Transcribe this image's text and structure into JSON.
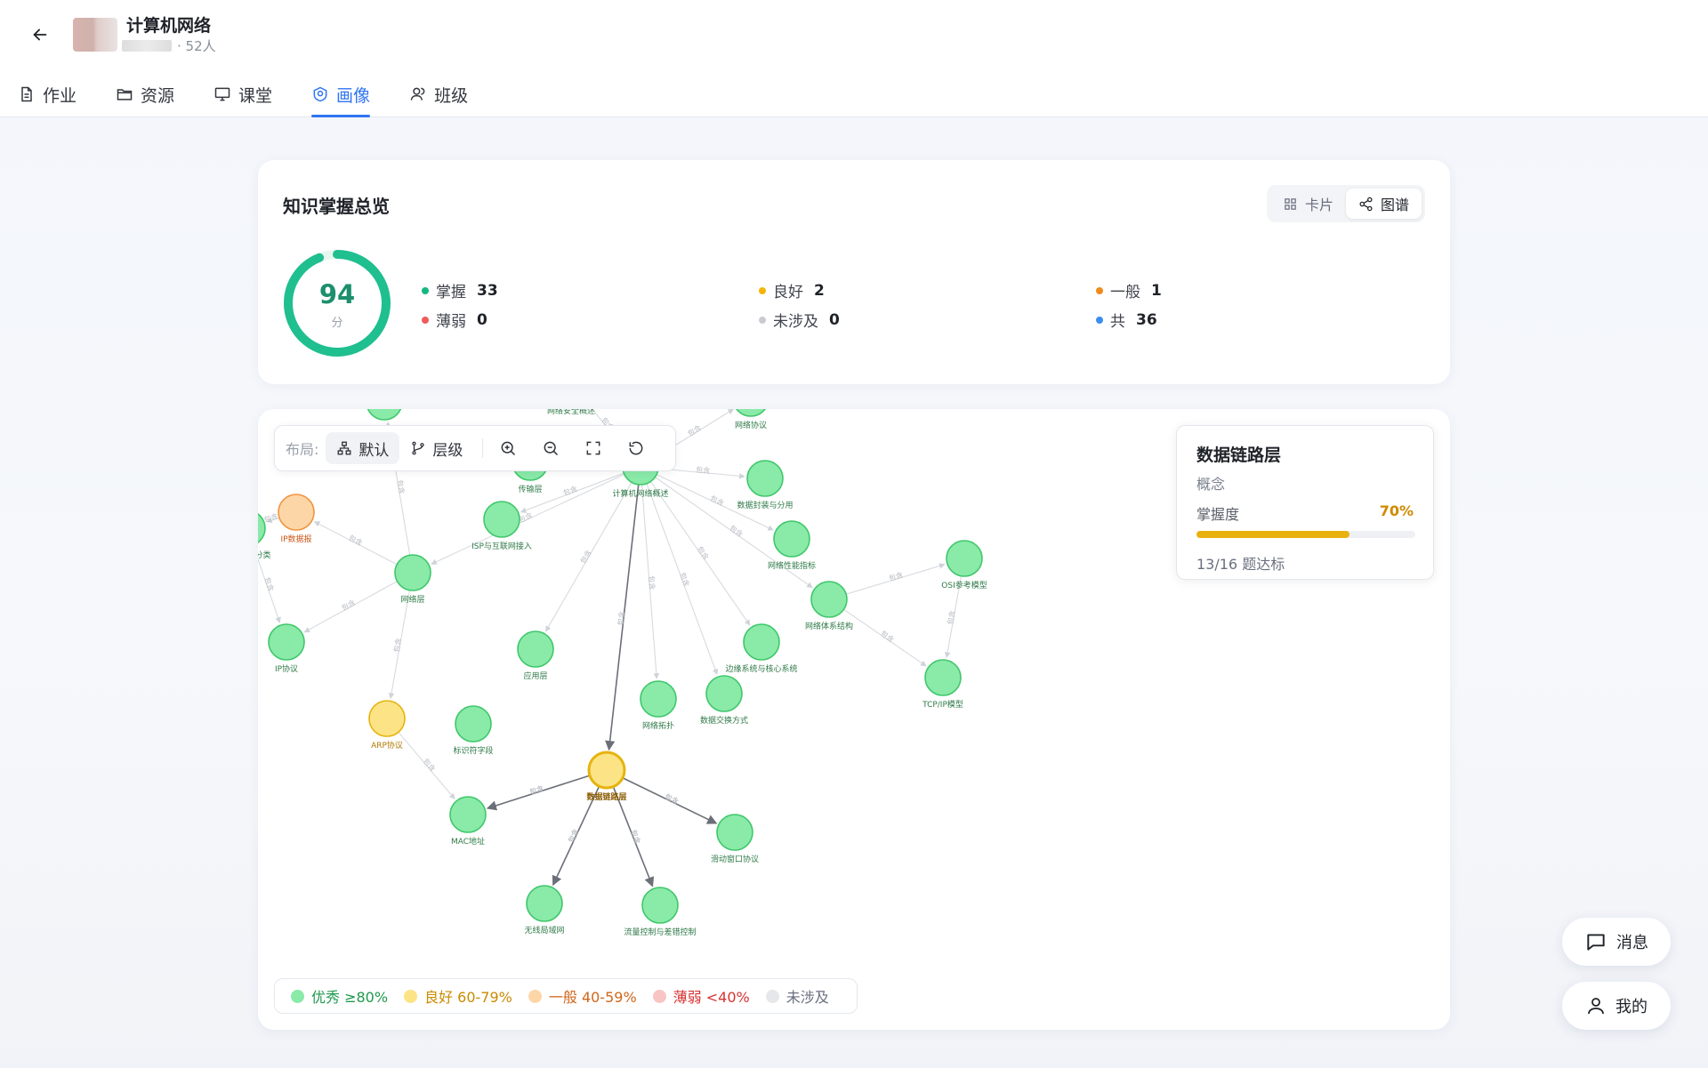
{
  "header": {
    "course_title": "计算机网络",
    "member_count": "· 52人"
  },
  "tabs": [
    {
      "label": "作业",
      "icon": "file-icon"
    },
    {
      "label": "资源",
      "icon": "folder-icon"
    },
    {
      "label": "课堂",
      "icon": "monitor-icon"
    },
    {
      "label": "画像",
      "icon": "portrait-icon",
      "active": true
    },
    {
      "label": "班级",
      "icon": "users-icon"
    }
  ],
  "overview": {
    "title": "知识掌握总览",
    "view_card": "卡片",
    "view_graph": "图谱",
    "score": "94",
    "score_unit": "分",
    "score_fraction": 0.94,
    "stats": [
      {
        "label": "掌握",
        "value": "33",
        "color": "#14b87e"
      },
      {
        "label": "薄弱",
        "value": "0",
        "color": "#ef5b5b"
      },
      {
        "label": "良好",
        "value": "2",
        "color": "#f4b40a"
      },
      {
        "label": "未涉及",
        "value": "0",
        "color": "#c8ccd2"
      },
      {
        "label": "一般",
        "value": "1",
        "color": "#f08a1c"
      },
      {
        "label": "共",
        "value": "36",
        "color": "#3b8ef0"
      }
    ]
  },
  "toolbar": {
    "layout_label": "布局:",
    "default_label": "默认",
    "level_label": "层级"
  },
  "detail": {
    "title": "数据链路层",
    "type": "概念",
    "mastery_label": "掌握度",
    "mastery_pct": "70%",
    "mastery_value": 0.7,
    "footer": "13/16 题达标"
  },
  "legend": [
    {
      "label": "优秀 ≥80%",
      "fill": "#8aeaa8",
      "text": "#1e9a4d"
    },
    {
      "label": "良好 60-79%",
      "fill": "#fce486",
      "text": "#c98b00"
    },
    {
      "label": "一般 40-59%",
      "fill": "#fdd6a8",
      "text": "#d0661b"
    },
    {
      "label": "薄弱 <40%",
      "fill": "#f9c4c4",
      "text": "#d83232"
    },
    {
      "label": "未涉及",
      "fill": "#e6e7ea",
      "text": "#6b7080"
    }
  ],
  "graph": {
    "edge_label": "包含",
    "nodes": [
      {
        "id": "root",
        "label": "计算机网络概述",
        "level": "excellent"
      },
      {
        "id": "security",
        "label": "网络安全概述",
        "level": "excellent"
      },
      {
        "id": "protocol",
        "label": "网络协议",
        "level": "excellent"
      },
      {
        "id": "encap",
        "label": "数据封装与分用",
        "level": "excellent"
      },
      {
        "id": "perf",
        "label": "网络性能指标",
        "level": "excellent"
      },
      {
        "id": "isp",
        "label": "ISP与互联网接入",
        "level": "excellent"
      },
      {
        "id": "transport",
        "label": "传输层",
        "level": "excellent"
      },
      {
        "id": "netlayer",
        "label": "网络层",
        "level": "excellent"
      },
      {
        "id": "ipdatagram",
        "label": "IP数据报",
        "level": "fair"
      },
      {
        "id": "ipaddr",
        "label": "IP地址与分类",
        "level": "excellent"
      },
      {
        "id": "ipproto",
        "label": "IP协议",
        "level": "excellent"
      },
      {
        "id": "arp",
        "label": "ARP协议",
        "level": "good"
      },
      {
        "id": "idfield",
        "label": "标识符字段",
        "level": "excellent"
      },
      {
        "id": "app",
        "label": "应用层",
        "level": "excellent"
      },
      {
        "id": "topo",
        "label": "网络拓扑",
        "level": "excellent"
      },
      {
        "id": "switch",
        "label": "数据交换方式",
        "level": "excellent"
      },
      {
        "id": "edgecore",
        "label": "边缘系统与核心系统",
        "level": "excellent"
      },
      {
        "id": "arch",
        "label": "网络体系结构",
        "level": "excellent"
      },
      {
        "id": "osi",
        "label": "OSI参考模型",
        "level": "excellent"
      },
      {
        "id": "tcpip",
        "label": "TCP/IP模型",
        "level": "excellent"
      },
      {
        "id": "datalink",
        "label": "数据链路层",
        "level": "good",
        "selected": true
      },
      {
        "id": "mac",
        "label": "MAC地址",
        "level": "excellent"
      },
      {
        "id": "sliding",
        "label": "滑动窗口协议",
        "level": "excellent"
      },
      {
        "id": "wireless",
        "label": "无线局域网",
        "level": "excellent"
      },
      {
        "id": "flow",
        "label": "流量控制与差错控制",
        "level": "excellent"
      },
      {
        "id": "topnode",
        "label": "",
        "level": "excellent"
      }
    ]
  }
}
